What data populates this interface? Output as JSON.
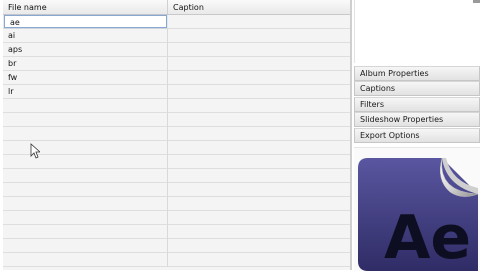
{
  "table": {
    "columns": [
      "File name",
      "Caption"
    ],
    "rows": [
      {
        "file": "ae",
        "caption": ""
      },
      {
        "file": "ai",
        "caption": ""
      },
      {
        "file": "aps",
        "caption": ""
      },
      {
        "file": "br",
        "caption": ""
      },
      {
        "file": "fw",
        "caption": ""
      },
      {
        "file": "lr",
        "caption": ""
      }
    ],
    "editing_row": 0
  },
  "panels": [
    "Album Properties",
    "Captions",
    "Filters",
    "Slideshow Properties",
    "Export Options"
  ],
  "preview": {
    "logo_text": "Ae",
    "bg_color": "#3f3b7a",
    "text_color": "#0e0e22"
  }
}
